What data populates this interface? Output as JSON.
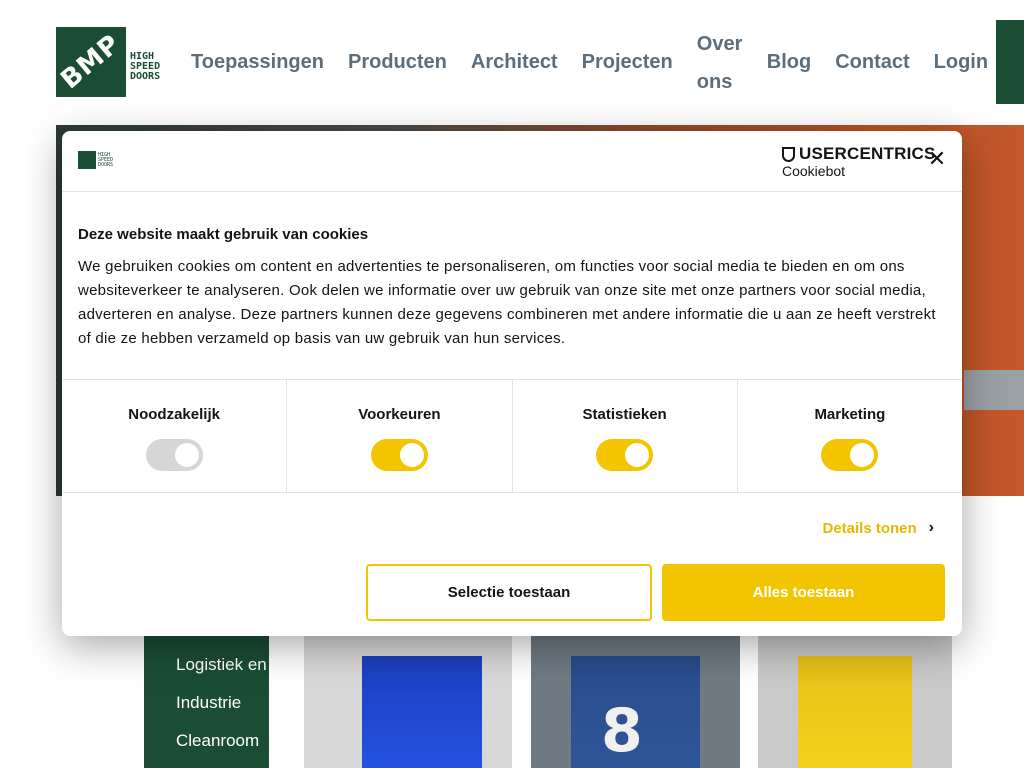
{
  "header": {
    "logo": {
      "mark": "BMP",
      "words": [
        "HIGH",
        "SPEED",
        "DOORS"
      ]
    },
    "nav": [
      {
        "label": "Toepassingen"
      },
      {
        "label": "Producten"
      },
      {
        "label": "Architect"
      },
      {
        "label": "Projecten"
      },
      {
        "label": "Over ons"
      },
      {
        "label": "Blog"
      },
      {
        "label": "Contact"
      },
      {
        "label": "Login"
      }
    ]
  },
  "side_menu": {
    "items": [
      "Logistiek en distributie",
      "Industrie",
      "Cleanroom"
    ]
  },
  "tiles": [
    {
      "number": ""
    },
    {
      "number": "8"
    },
    {
      "number": ""
    }
  ],
  "cookie_dialog": {
    "brand_title": "USERCENTRICS",
    "brand_sub": "Cookiebot",
    "close_icon": "close-icon",
    "heading": "Deze website maakt gebruik van cookies",
    "body": "We gebruiken cookies om content en advertenties te personaliseren, om functies voor social media te bieden en om ons websiteverkeer te analyseren. Ook delen we informatie over uw gebruik van onze site met onze partners voor social media, adverteren en analyse. Deze partners kunnen deze gegevens combineren met andere informatie die u aan ze heeft verstrekt of die ze hebben verzameld op basis van uw gebruik van hun services.",
    "categories": [
      {
        "label": "Noodzakelijk",
        "enabled": true,
        "disabled": true
      },
      {
        "label": "Voorkeuren",
        "enabled": true,
        "disabled": false
      },
      {
        "label": "Statistieken",
        "enabled": true,
        "disabled": false
      },
      {
        "label": "Marketing",
        "enabled": true,
        "disabled": false
      }
    ],
    "details_label": "Details tonen",
    "btn_selection": "Selectie toestaan",
    "btn_all": "Alles toestaan"
  },
  "colors": {
    "brand_green": "#1b4d34",
    "accent_yellow": "#f2c500",
    "nav_text": "#5c6e7b"
  }
}
